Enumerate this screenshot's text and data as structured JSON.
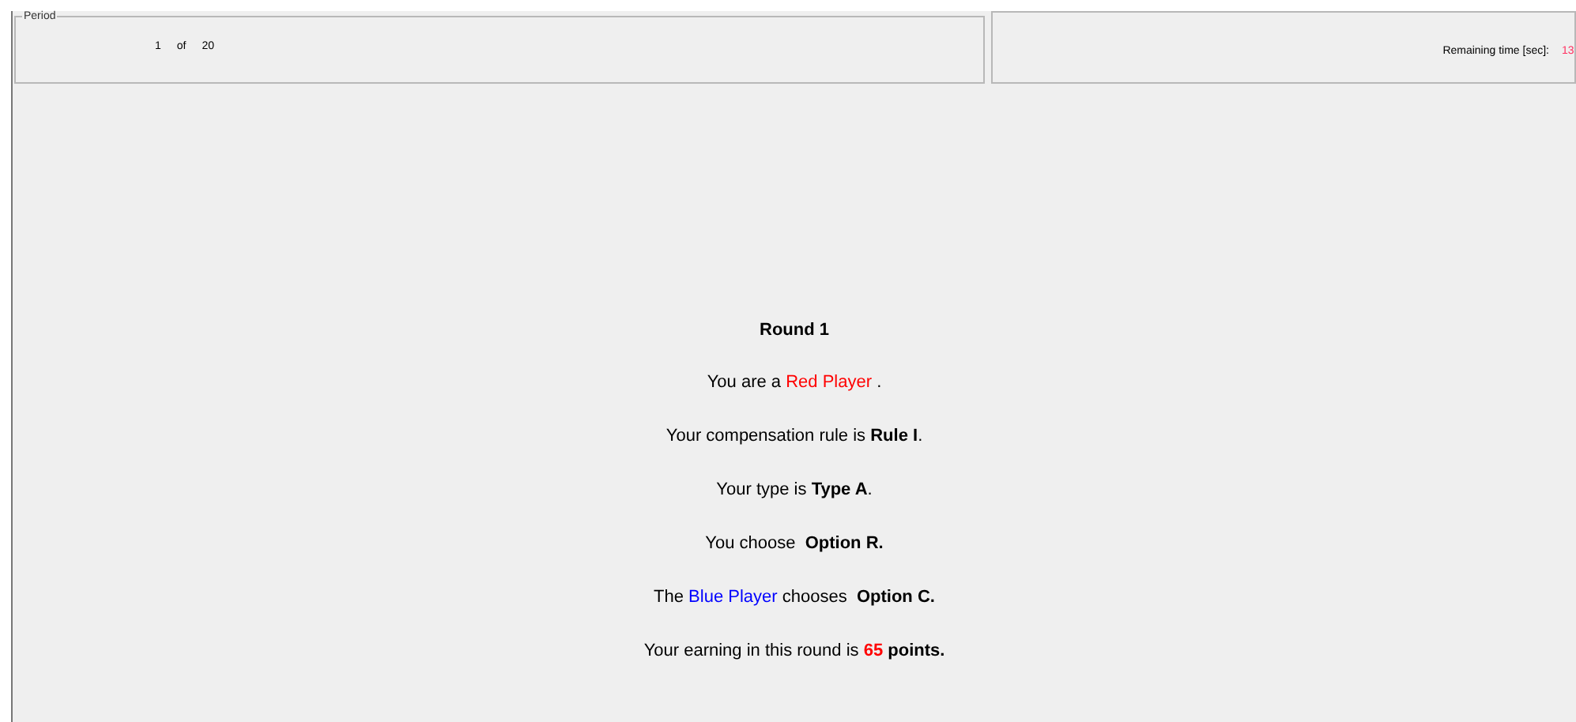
{
  "period_panel": {
    "legend": "Period",
    "current": "1",
    "separator": "of",
    "total": "20"
  },
  "time_panel": {
    "label": "Remaining time [sec]:",
    "value": "13"
  },
  "result": {
    "title": "Round 1",
    "lines": [
      {
        "segments": [
          {
            "text": "You are a ",
            "bold": false
          },
          {
            "text": "Red Player",
            "bold": false,
            "color": "#ff0000"
          },
          {
            "text": " .",
            "bold": false
          }
        ]
      },
      {
        "segments": [
          {
            "text": "Your compensation rule is ",
            "bold": false
          },
          {
            "text": "Rule I",
            "bold": true
          },
          {
            "text": ".",
            "bold": false
          }
        ]
      },
      {
        "segments": [
          {
            "text": "Your type is ",
            "bold": false
          },
          {
            "text": "Type A",
            "bold": true
          },
          {
            "text": ".",
            "bold": false
          }
        ]
      },
      {
        "segments": [
          {
            "text": "You choose  ",
            "bold": false
          },
          {
            "text": "Option R.",
            "bold": true
          }
        ]
      },
      {
        "segments": [
          {
            "text": "The ",
            "bold": false
          },
          {
            "text": "Blue Player",
            "bold": false,
            "color": "#0000ff"
          },
          {
            "text": " chooses  ",
            "bold": false
          },
          {
            "text": "Option C.",
            "bold": true
          }
        ]
      },
      {
        "segments": [
          {
            "text": "Your earning in this round is ",
            "bold": false
          },
          {
            "text": "65",
            "bold": true,
            "color": "#ff0000"
          },
          {
            "text": " points.",
            "bold": true
          }
        ]
      }
    ]
  }
}
